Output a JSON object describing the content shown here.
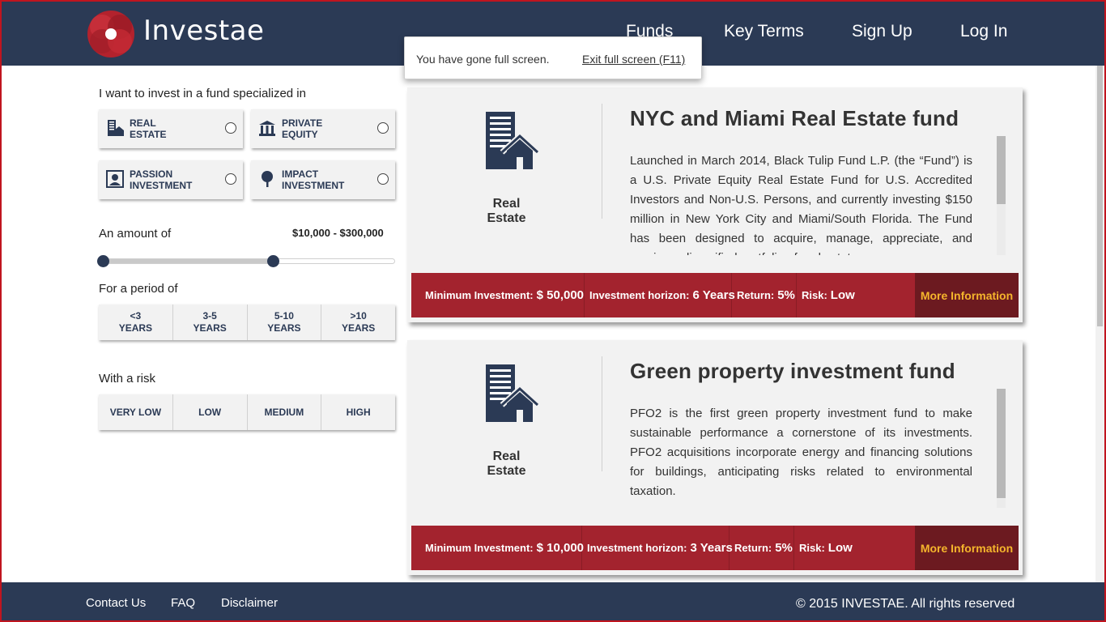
{
  "header": {
    "brand": "Investae",
    "nav": [
      "Funds",
      "Key Terms",
      "Sign Up",
      "Log In"
    ]
  },
  "fullscreen_notice": {
    "message": "You have gone full screen.",
    "exit_label": "Exit full screen (F11)"
  },
  "filters": {
    "sector_label": "I want to invest in a fund specialized in",
    "sectors": [
      {
        "line1": "REAL",
        "line2": "ESTATE",
        "icon": "building-icon"
      },
      {
        "line1": "PRIVATE",
        "line2": "EQUITY",
        "icon": "bank-icon"
      },
      {
        "line1": "PASSION",
        "line2": "INVESTMENT",
        "icon": "portrait-icon"
      },
      {
        "line1": "IMPACT",
        "line2": "INVESTMENT",
        "icon": "tree-icon"
      }
    ],
    "amount_label": "An amount of",
    "amount_value": "$10,000 - $300,000",
    "amount_slider": {
      "low_fraction": 0.0,
      "high_fraction": 0.59
    },
    "period_label": "For a period of",
    "periods": [
      {
        "line1": "<3",
        "line2": "YEARS"
      },
      {
        "line1": "3-5",
        "line2": "YEARS"
      },
      {
        "line1": "5-10",
        "line2": "YEARS"
      },
      {
        "line1": ">10",
        "line2": "YEARS"
      }
    ],
    "risk_label": "With a risk",
    "risks": [
      "VERY LOW",
      "LOW",
      "MEDIUM",
      "HIGH"
    ]
  },
  "funds": [
    {
      "category": "Real Estate",
      "title": "NYC and Miami Real Estate fund",
      "description": "Launched in March 2014, Black Tulip Fund L.P. (the “Fund”) is a U.S. Private Equity Real Estate Fund for U.S. Accredited Investors and Non-U.S. Persons, and currently investing $150 million in New York City and Miami/South Florida. The Fund has been designed to acquire, manage, appreciate, and receive a diversified portfolio of real estate",
      "min_label": "Minimum Investment:",
      "min_value": "$ 50,000",
      "horizon_label": "Investment horizon:",
      "horizon_value": "6 Years",
      "return_label": "Return:",
      "return_value": "5%",
      "risk_label": "Risk:",
      "risk_value": "Low",
      "more_label": "More Information"
    },
    {
      "category": "Real Estate",
      "title": "Green property investment fund",
      "description": "PFO2 is the first green property investment fund to make sustainable performance a cornerstone of its investments. PFO2 acquisitions incorporate energy and financing solutions for buildings, anticipating risks related to environmental taxation.",
      "min_label": "Minimum Investment:",
      "min_value": "$ 10,000",
      "horizon_label": "Investment horizon:",
      "horizon_value": "3 Years",
      "return_label": "Return:",
      "return_value": "5%",
      "risk_label": "Risk:",
      "risk_value": "Low",
      "more_label": "More Information"
    }
  ],
  "footer": {
    "links": [
      "Contact Us",
      "FAQ",
      "Disclaimer"
    ],
    "copyright": "© 2015 INVESTAE. All rights reserved"
  },
  "colors": {
    "navy": "#2b3a55",
    "crimson": "#a3232e",
    "dark_crimson": "#6c1a20",
    "gold": "#f5b52c"
  }
}
